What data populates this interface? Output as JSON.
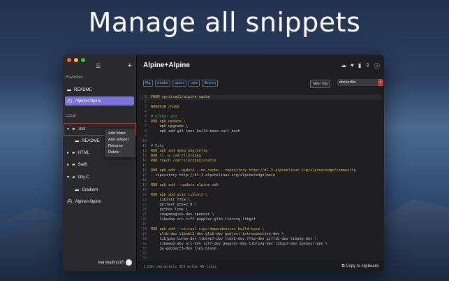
{
  "headline": "Manage all snippets",
  "sidebar": {
    "favorites_label": "Favorites",
    "favorites": [
      {
        "label": "README",
        "selected": false,
        "icon": "doc-icon"
      },
      {
        "label": "Alpine+Alpine",
        "selected": true,
        "icon": "docker-icon"
      }
    ],
    "local_label": "Local",
    "local": [
      {
        "label": ".md",
        "icon": "folder-icon",
        "expanded": true
      },
      {
        "label": "README",
        "icon": "doc-icon"
      },
      {
        "label": "HTML",
        "icon": "folder-icon"
      },
      {
        "label": "Swift",
        "icon": "folder-icon"
      },
      {
        "label": "Obj-C",
        "icon": "folder-icon"
      },
      {
        "label": "Gradient",
        "icon": "doc-icon"
      },
      {
        "label": "Alpine+Alpine",
        "icon": "docker-icon"
      }
    ],
    "context_menu": [
      "Add folder",
      "Add snippet",
      "Rename",
      "Delete"
    ],
    "username": "marshallino16"
  },
  "main": {
    "title": "Alpine+Alpine",
    "tags": [
      "fftg",
      "cmake",
      "alpine",
      "vips",
      "ffmpeg"
    ],
    "new_tag_label": "New Tag",
    "language": "dockerfile",
    "stats": "1,530 characters 323 words 48 lines",
    "copy_label": "Copy to clipboard"
  },
  "code_lines": [
    "FROM spritsail/alpine-cmake",
    "",
    "WORKDIR /home",
    "",
    "# Global env",
    "RUN apk update \\",
    "    apk upgrade \\",
    "    apk add git tmux build-base curl bash",
    "",
    "",
    "# Dpkg",
    "RUN apk add dpkg pkgconfig",
    "RUN ls -a /var/lib/dpkg",
    "RUN touch /var/lib/dpkg/status",
    "",
    "RUN apk add --update --no-cache --repository http://dl-3.alpinelinux.org/alpine/edge/community",
    "--repository http://dl-3.alpinelinux.org/alpine/edge/main",
    "",
    "RUN apk add --update alpine-sdk",
    "",
    "RUN apk add glib libxml2 \\",
    "    libxslt fftw \\",
    "    gettext gtk+2.0 \\",
    "    python lcms \\",
    "    imagemagick-dev openexr \\",
    "    libwebp orc tiff poppler-glib librsvg libgsf",
    "",
    "RUN apk add --virtual vips-dependencies build-base \\",
    "    zlib-dev libxml2-dev glib-dev gobject-introspection-dev \\",
    "    libjpeg-turbo-dev libexif-dev lcms2-dev fftw-dev giflib-dev libpng-dev \\",
    "    libwebp-dev orc-dev tiff-dev poppler-dev librsvg-dev libgsf-dev openexr-dev \\",
    "    py-gobject3-dev flex bison",
    "",
    ""
  ],
  "colors": {
    "accent": "#7b74d8",
    "select_arrow": "#c0392b",
    "traffic_red": "#ff5f57",
    "traffic_yellow": "#febc2e",
    "traffic_green": "#28c840"
  }
}
